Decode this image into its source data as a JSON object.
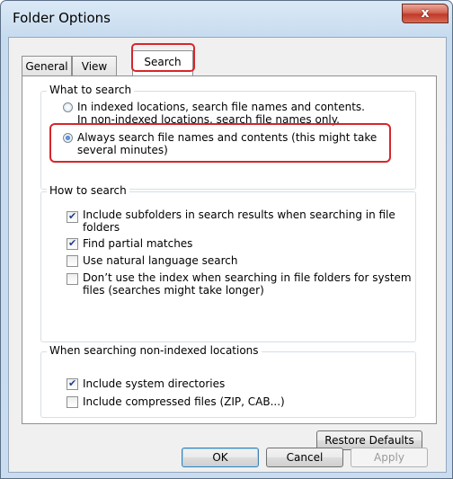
{
  "window": {
    "title": "Folder Options",
    "close_label": "x"
  },
  "tabs": [
    {
      "label": "General"
    },
    {
      "label": "View"
    },
    {
      "label": "Search"
    }
  ],
  "what_to_search": {
    "title": "What to search",
    "option1_line1": "In indexed locations, search file names and contents.",
    "option1_line2": "In non-indexed locations, search file names only.",
    "option2_line1": "Always search file names and contents (this might take",
    "option2_line2": "several minutes)",
    "selected": 2
  },
  "how_to_search": {
    "title": "How to search",
    "items": [
      {
        "line1": "Include subfolders in search results when searching in file",
        "line2": "folders",
        "checked": true
      },
      {
        "line1": "Find partial matches",
        "line2": "",
        "checked": true
      },
      {
        "line1": "Use natural language search",
        "line2": "",
        "checked": false
      },
      {
        "line1": "Don’t use the index when searching in file folders for system",
        "line2": "files (searches might take longer)",
        "checked": false
      }
    ]
  },
  "non_indexed": {
    "title": "When searching non-indexed locations",
    "items": [
      {
        "label": "Include system directories",
        "checked": true
      },
      {
        "label": "Include compressed files (ZIP, CAB...)",
        "checked": false
      }
    ]
  },
  "buttons": {
    "restore": "Restore Defaults",
    "ok": "OK",
    "cancel": "Cancel",
    "apply": "Apply"
  },
  "colors": {
    "highlight": "#d6262b",
    "accent": "#1c5fb8"
  }
}
